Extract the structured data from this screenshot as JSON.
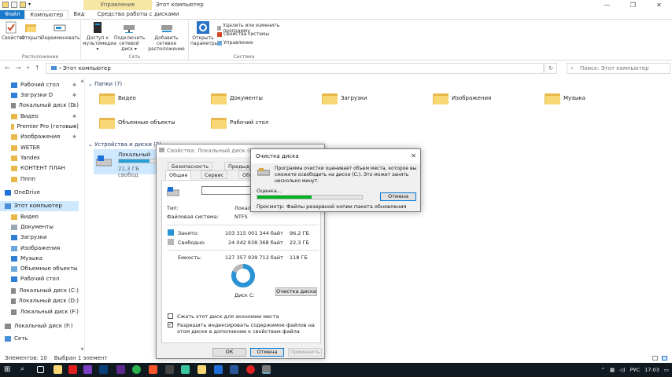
{
  "window": {
    "title": "Этот компьютер",
    "context_tab": "Управление",
    "controls": [
      "—",
      "❐",
      "✕"
    ]
  },
  "tabs": [
    "Файл",
    "Компьютер",
    "Вид",
    "Средства работы с дисками"
  ],
  "ribbon": {
    "groups": [
      {
        "label": "Расположение",
        "buttons": [
          "Свойства",
          "Открыть",
          "Переименовать"
        ]
      },
      {
        "label": "Сеть",
        "buttons": [
          "Доступ к мультимедиа ▾",
          "Подключить сетевой диск ▾",
          "Добавить сетевое расположение"
        ]
      },
      {
        "label": "Система",
        "buttons": [
          "Открыть параметры"
        ],
        "small": [
          "Удалить или изменить программу",
          "Свойства системы",
          "Управление"
        ]
      }
    ]
  },
  "address": {
    "path": "Этот компьютер",
    "search_placeholder": "Поиск: Этот компьютер"
  },
  "sidebar": {
    "items": [
      {
        "label": "Рабочий стол",
        "pinned": true,
        "color": "#2f7fd6"
      },
      {
        "label": "Загрузки D",
        "pinned": true,
        "color": "#2f7fd6"
      },
      {
        "label": "Локальный диск (D:)",
        "pinned": true,
        "color": "#888888"
      },
      {
        "label": "Видео",
        "pinned": true,
        "color": "#e8b84a"
      },
      {
        "label": "Premier Pro (готовые)",
        "pinned": true,
        "color": "#e8b84a"
      },
      {
        "label": "Изображения",
        "pinned": true,
        "color": "#e8b84a"
      },
      {
        "label": "WETER",
        "pinned": false,
        "color": "#e8b84a"
      },
      {
        "label": "Yandex",
        "pinned": false,
        "color": "#e8b84a"
      },
      {
        "label": "КОНТЕНТ ПЛАН",
        "pinned": false,
        "color": "#e8b84a"
      },
      {
        "label": "Пппп",
        "pinned": false,
        "color": "#e8b84a"
      },
      {
        "label": "OneDrive",
        "pinned": false,
        "color": "#1e6fd9"
      },
      {
        "label": "Этот компьютер",
        "pinned": false,
        "color": "#4a8fd6",
        "selected": true
      },
      {
        "label": "Видео",
        "pinned": false,
        "color": "#e8b84a"
      },
      {
        "label": "Документы",
        "pinned": false,
        "color": "#9aa7b5"
      },
      {
        "label": "Загрузки",
        "pinned": false,
        "color": "#2f7fd6"
      },
      {
        "label": "Изображения",
        "pinned": false,
        "color": "#6ea8d8"
      },
      {
        "label": "Музыка",
        "pinned": false,
        "color": "#2f7fd6"
      },
      {
        "label": "Объемные объекты",
        "pinned": false,
        "color": "#6ea8d8"
      },
      {
        "label": "Рабочий стол",
        "pinned": false,
        "color": "#2f7fd6"
      },
      {
        "label": "Локальный диск (C:)",
        "pinned": false,
        "color": "#888888"
      },
      {
        "label": "Локальный диск (D:)",
        "pinned": false,
        "color": "#888888"
      },
      {
        "label": "Локальный диск (F:)",
        "pinned": false,
        "color": "#888888"
      },
      {
        "label": "Локальный диск (F:)",
        "pinned": false,
        "color": "#888888"
      },
      {
        "label": "Сеть",
        "pinned": false,
        "color": "#4a8fd6"
      }
    ]
  },
  "main": {
    "folders_header": "Папки (7)",
    "folders": [
      "Видео",
      "Документы",
      "Загрузки",
      "Изображения",
      "Музыка",
      "Объемные объекты",
      "Рабочий стол"
    ],
    "devices_header": "Устройства и диски (3)",
    "drive": {
      "name": "Локальный диск",
      "free_text": "22,3 ГБ свобод"
    }
  },
  "status": {
    "count": "Элементов: 10",
    "selected": "Выбран 1 элемент"
  },
  "props": {
    "title": "Свойства: Локальный диск (C:)",
    "tabs_row1": [
      "Безопасность",
      "Предыду"
    ],
    "tabs_row2": [
      "Общие",
      "Сервис",
      "Обо"
    ],
    "type_label": "Тип:",
    "type_value": "Локальный дис",
    "fs_label": "Файловая система:",
    "fs_value": "NTFS",
    "used_label": "Занято:",
    "used_bytes": "103 315 001 344 байт",
    "used_gb": "96,2 ГБ",
    "free_label": "Свободно:",
    "free_bytes": "24 042 938 368 байт",
    "free_gb": "22,3 ГБ",
    "cap_label": "Емкость:",
    "cap_bytes": "127 357 939 712 байт",
    "cap_gb": "118 ГБ",
    "used_fraction": 0.811,
    "disk_label": "Диск C:",
    "cleanup_button": "Очистка диска",
    "compress_label": "Сжать этот диск для экономии места",
    "index_label": "Разрешить индексировать содержимое файлов на этом диске в дополнение к свойствам файла",
    "index_checked": true,
    "ok": "ОК",
    "cancel": "Отмена",
    "apply": "Применить",
    "used_color": "#2a93d5",
    "free_color": "#b7b7b7"
  },
  "cleanup": {
    "title": "Очистка диска",
    "message": "Программа очистки оценивает объем места, которое вы сможете освободить на диске (C:). Это может занять несколько минут.",
    "estimate_label": "Оценка...",
    "cancel": "Отмена",
    "progress": 0.52,
    "scan_label": "Просмотр:",
    "scan_value": "Файлы резервной копии пакета обновления"
  },
  "tray": {
    "lang": "РУС",
    "time": "17:03"
  }
}
